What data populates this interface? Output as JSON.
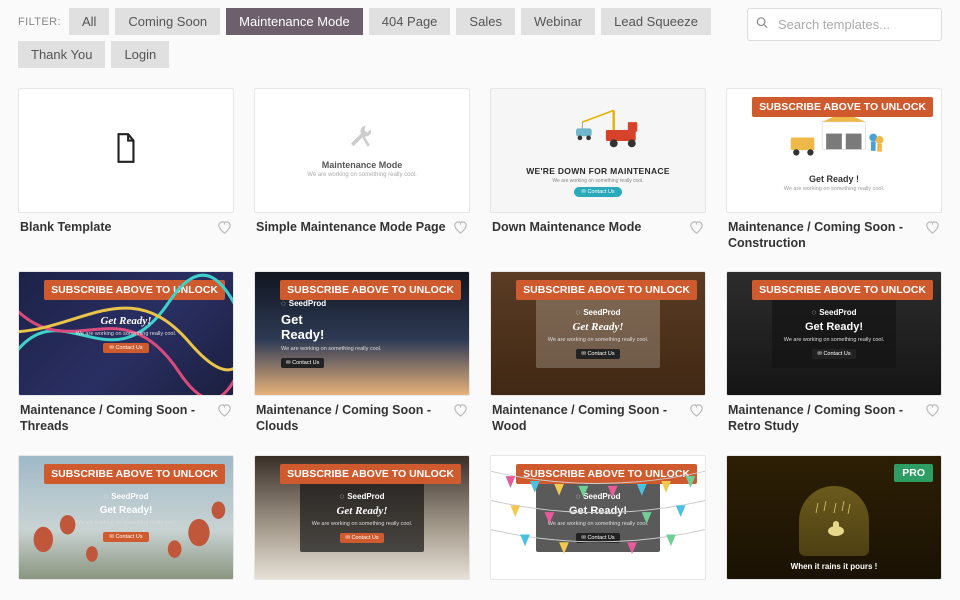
{
  "filter": {
    "label": "FILTER:",
    "items": [
      {
        "label": "All"
      },
      {
        "label": "Coming Soon"
      },
      {
        "label": "Maintenance Mode"
      },
      {
        "label": "404 Page"
      },
      {
        "label": "Sales"
      },
      {
        "label": "Webinar"
      },
      {
        "label": "Lead Squeeze"
      },
      {
        "label": "Thank You"
      },
      {
        "label": "Login"
      }
    ],
    "active_index": 2
  },
  "search": {
    "placeholder": "Search templates..."
  },
  "badges": {
    "unlock": "SUBSCRIBE ABOVE TO UNLOCK",
    "pro": "PRO"
  },
  "seedprod": {
    "brand": "SeedProd",
    "get_ready": "Get Ready!",
    "sub": "We are working on something really cool.",
    "contact": "✉ Contact Us"
  },
  "templates": [
    {
      "title": "Blank Template"
    },
    {
      "title": "Simple Maintenance Mode Page",
      "mm_heading": "Maintenance Mode"
    },
    {
      "title": "Down Maintenance Mode",
      "heading": "WE'RE DOWN FOR MAINTENACE"
    },
    {
      "title": "Maintenance / Coming Soon - Construction",
      "heading": "Get Ready !"
    },
    {
      "title": "Maintenance / Coming Soon - Threads"
    },
    {
      "title": "Maintenance / Coming Soon - Clouds"
    },
    {
      "title": "Maintenance / Coming Soon - Wood"
    },
    {
      "title": "Maintenance / Coming Soon - Retro Study"
    },
    {
      "title": ""
    },
    {
      "title": ""
    },
    {
      "title": ""
    },
    {
      "title": "",
      "rain_title": "When it rains it pours !"
    }
  ]
}
